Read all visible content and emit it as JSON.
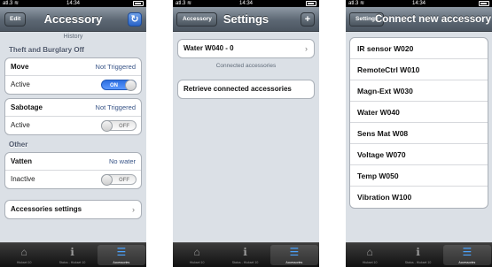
{
  "status_bar": {
    "carrier": "atl.3",
    "wifi": "≋",
    "time": "14:34",
    "bluetooth": "✱"
  },
  "tabs": [
    {
      "label": "Hiukset 10",
      "icon": "home-icon"
    },
    {
      "label": "Status - Hiukset 10",
      "icon": "info-icon"
    },
    {
      "label": "Accessories",
      "icon": "list-icon"
    }
  ],
  "screen1": {
    "nav": {
      "left_button": "Edit",
      "title": "Accessory",
      "right_button": "↻"
    },
    "history_label": "History",
    "section1_title": "Theft and Burglary Off",
    "move": {
      "label": "Move",
      "value": "Not Triggered",
      "active_label": "Active",
      "toggle": "ON"
    },
    "sabotage": {
      "label": "Sabotage",
      "value": "Not Triggered",
      "active_label": "Active",
      "toggle": "OFF"
    },
    "section2_title": "Other",
    "vatten": {
      "label": "Vatten",
      "value": "No water",
      "active_label": "Inactive",
      "toggle": "OFF"
    },
    "settings_row": "Accessories settings",
    "chevron": "›"
  },
  "screen2": {
    "nav": {
      "left_button": "Accessory",
      "title": "Settings",
      "right_button": "+"
    },
    "device_row": "Water W040 - 0",
    "connected_label": "Connected accessories",
    "retrieve_row": "Retrieve connected accessories",
    "chevron": "›"
  },
  "screen3": {
    "nav": {
      "left_button": "Settings",
      "title": "Connect new accessory"
    },
    "accessories": [
      "IR sensor W020",
      "RemoteCtrl W010",
      "Magn-Ext W030",
      "Water W040",
      "Sens Mat W08",
      "Voltage W070",
      "Temp W050",
      "Vibration W100"
    ]
  },
  "colors": {
    "accent": "#2a64c8",
    "value_text": "#385487",
    "background": "#dbe0e6"
  }
}
